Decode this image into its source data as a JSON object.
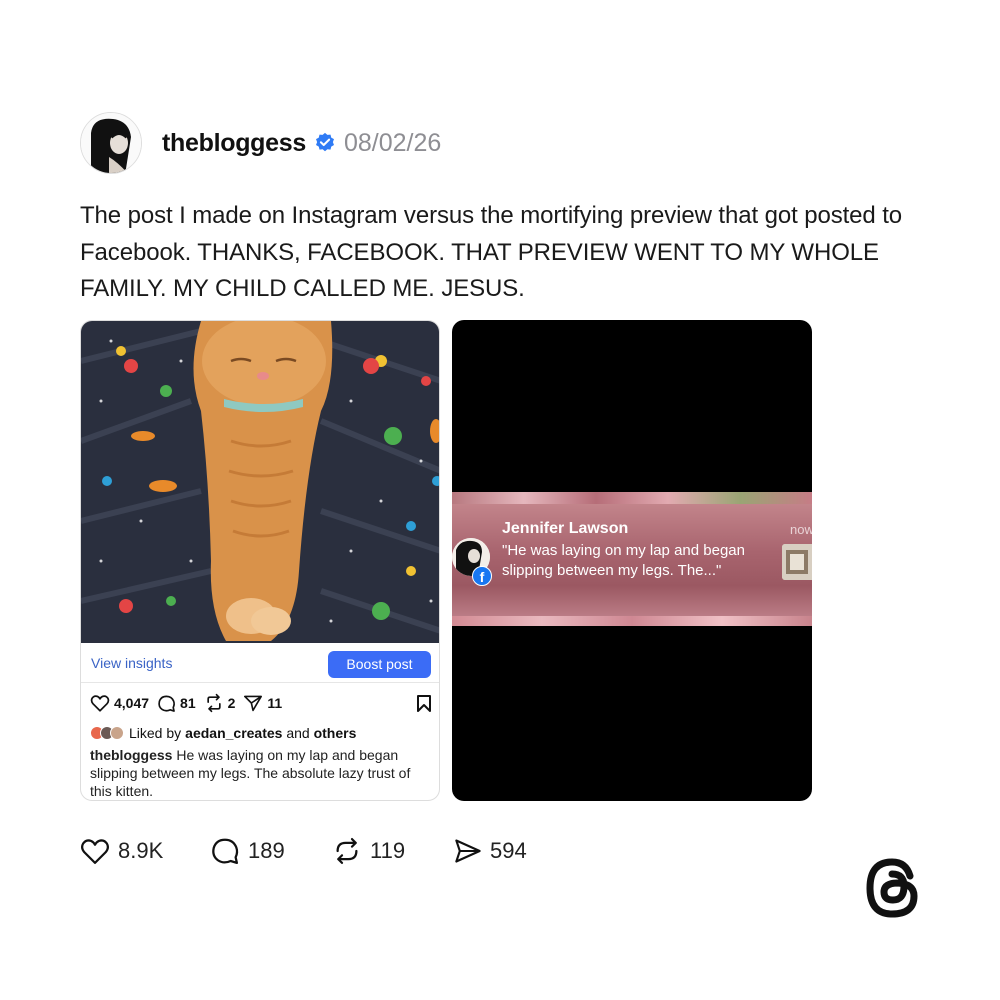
{
  "post": {
    "username": "thebloggess",
    "date": "08/02/26",
    "text": "The post I made on Instagram versus the mortifying preview that got posted to Facebook. THANKS, FACEBOOK. THAT PREVIEW WENT TO MY WHOLE FAMILY. MY CHILD CALLED ME. JESUS."
  },
  "instagram_card": {
    "view_insights": "View insights",
    "boost_post": "Boost post",
    "likes": "4,047",
    "comments": "81",
    "reposts": "2",
    "shares": "11",
    "liked_by_prefix": "Liked by ",
    "liked_by_user": "aedan_creates",
    "liked_by_and": " and ",
    "liked_by_others": "others",
    "caption_user": "thebloggess",
    "caption_text": " He was laying on my lap and began slipping between my legs. The absolute lazy trust of this kitten."
  },
  "facebook_notification": {
    "name": "Jennifer Lawson",
    "message": "\"He was laying on my lap and began slipping between my legs. The...\"",
    "time": "now",
    "badge": "f"
  },
  "footer": {
    "likes": "8.9K",
    "replies": "189",
    "reposts": "119",
    "shares": "594"
  },
  "icons": [
    "heart-icon",
    "comment-icon",
    "repost-icon",
    "share-icon",
    "bookmark-icon",
    "verified-icon",
    "threads-logo-icon"
  ],
  "colors": {
    "verified": "#2f7bf5",
    "boost_button": "#3b6cf6",
    "link": "#3a63c6",
    "facebook": "#1877f2"
  }
}
